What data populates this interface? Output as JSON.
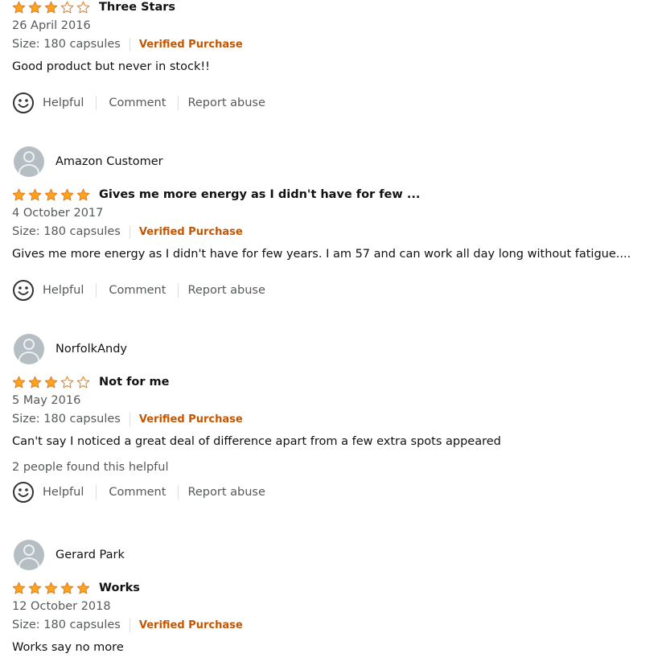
{
  "colors": {
    "star": "#ffa41c",
    "star_outline": "#de7921",
    "verified": "#c45500",
    "muted": "#565959",
    "text": "#111111"
  },
  "actions": {
    "helpful": "Helpful",
    "comment": "Comment",
    "report": "Report abuse"
  },
  "reviews": [
    {
      "author": "",
      "rating": 3,
      "title": "Three Stars",
      "date": "26 April 2016",
      "size": "Size: 180 capsules",
      "verified": "Verified Purchase",
      "body": "Good product but never in stock!!",
      "helpful_count": ""
    },
    {
      "author": "Amazon Customer",
      "rating": 5,
      "title": "Gives me more energy as I didn't have for few ...",
      "date": "4 October 2017",
      "size": "Size: 180 capsules",
      "verified": "Verified Purchase",
      "body": "Gives me more energy as I didn't have for few years. I am 57 and can work all day long without fatigue....",
      "helpful_count": ""
    },
    {
      "author": "NorfolkAndy",
      "rating": 3,
      "title": "Not for me",
      "date": "5 May 2016",
      "size": "Size: 180 capsules",
      "verified": "Verified Purchase",
      "body": "Can't say I noticed a great deal of difference apart from a few extra spots appeared",
      "helpful_count": "2 people found this helpful"
    },
    {
      "author": "Gerard Park",
      "rating": 5,
      "title": "Works",
      "date": "12 October 2018",
      "size": "Size: 180 capsules",
      "verified": "Verified Purchase",
      "body": "Works say no more",
      "helpful_count": ""
    }
  ]
}
